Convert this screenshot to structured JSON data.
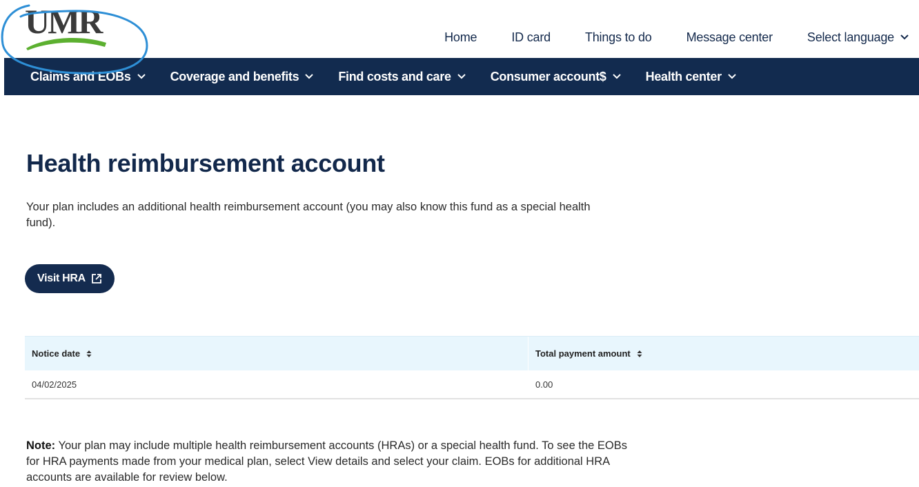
{
  "brand": {
    "logo_text": "UMR",
    "accent": "#5cb030",
    "navy": "#122b4f"
  },
  "utility_nav": {
    "home": "Home",
    "id_card": "ID card",
    "things_to_do": "Things to do",
    "message_center": "Message center",
    "select_language": "Select language"
  },
  "main_nav": {
    "claims": "Claims and EOBs",
    "coverage": "Coverage and benefits",
    "find_costs": "Find costs and care",
    "consumer": "Consumer account$",
    "health_center": "Health center"
  },
  "page": {
    "title": "Health reimbursement account",
    "intro": "Your plan includes an additional health reimbursement account (you may also know this fund as a special health fund).",
    "visit_button": "Visit HRA"
  },
  "table": {
    "headers": [
      "Notice date",
      "Total payment amount"
    ],
    "rows": [
      [
        "04/02/2025",
        "0.00"
      ]
    ]
  },
  "note": {
    "label": "Note:",
    "text": " Your plan may include multiple health reimbursement accounts (HRAs) or a special health fund. To see the EOBs for HRA payments made from your medical plan, select View details and select your claim. EOBs for additional HRA accounts are available for review below."
  },
  "icons": {
    "external": "external-link-icon",
    "chevron": "chevron-down-icon",
    "sort": "sort-icon"
  }
}
